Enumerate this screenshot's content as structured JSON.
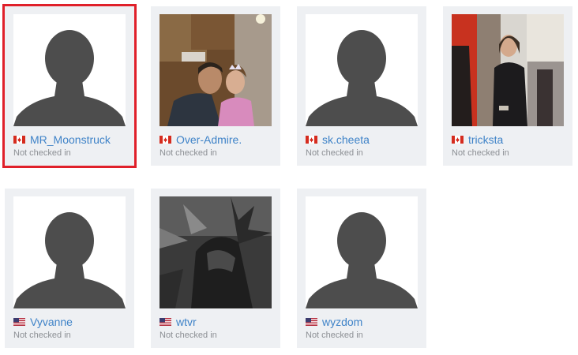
{
  "players": [
    {
      "name": "MR_Moonstruck",
      "status": "Not checked in",
      "country": "canada-flag-icon",
      "avatar": "default-silhouette",
      "selected": true
    },
    {
      "name": "Over-Admire.",
      "status": "Not checked in",
      "country": "canada-flag-icon",
      "avatar": "photo-man-with-child",
      "selected": false
    },
    {
      "name": "sk.cheeta",
      "status": "Not checked in",
      "country": "canada-flag-icon",
      "avatar": "default-silhouette",
      "selected": false
    },
    {
      "name": "tricksta",
      "status": "Not checked in",
      "country": "canada-flag-icon",
      "avatar": "photo-man-in-store",
      "selected": false
    },
    {
      "name": "Vyvanne",
      "status": "Not checked in",
      "country": "usa-flag-icon",
      "avatar": "default-silhouette",
      "selected": false
    },
    {
      "name": "wtvr",
      "status": "Not checked in",
      "country": "usa-flag-icon",
      "avatar": "photo-dark-helmet",
      "selected": false
    },
    {
      "name": "wyzdom",
      "status": "Not checked in",
      "country": "usa-flag-icon",
      "avatar": "default-silhouette",
      "selected": false
    }
  ],
  "colors": {
    "card_bg": "#eef0f3",
    "name_link": "#3f83c8",
    "status_text": "#8c8f94",
    "selected_outline": "#e0202a",
    "silhouette": "#4d4d4d"
  }
}
